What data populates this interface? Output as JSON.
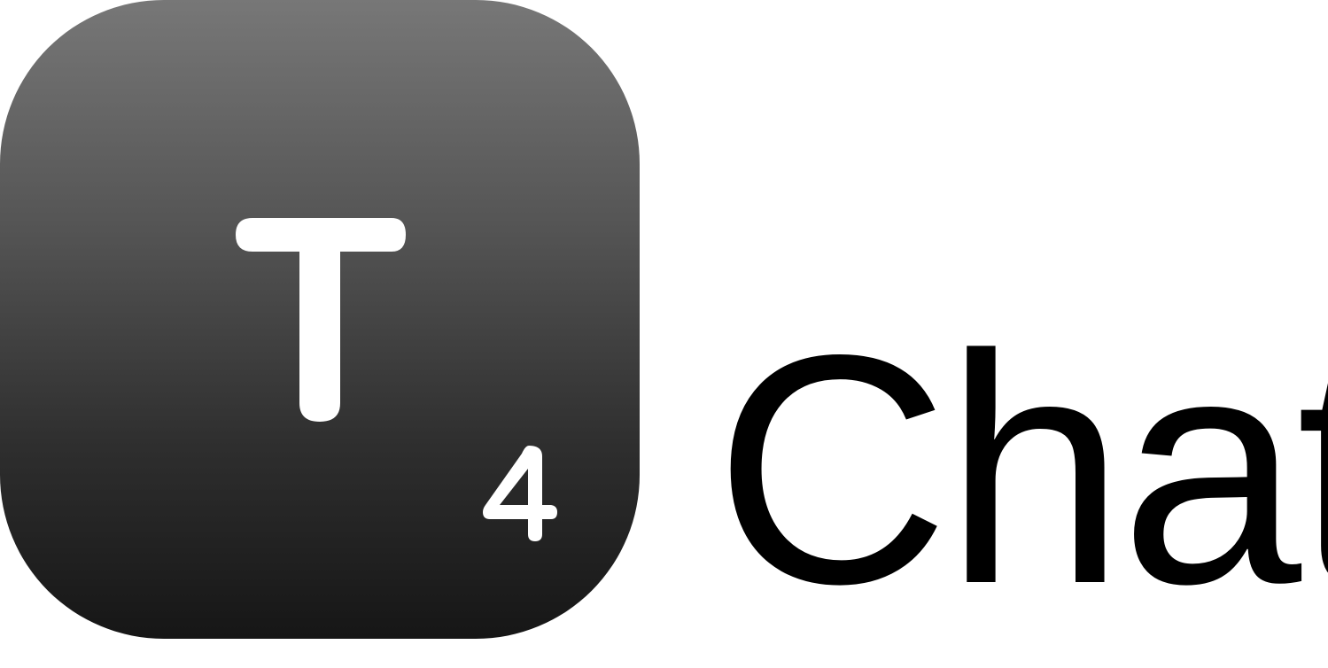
{
  "logo": {
    "tile_letter": "T",
    "tile_subscript": "4",
    "wordmark": "Chat",
    "colors": {
      "tile_top": "#777777",
      "tile_bottom": "#161616",
      "glyph": "#ffffff",
      "wordmark": "#000000",
      "background": "#ffffff"
    }
  }
}
